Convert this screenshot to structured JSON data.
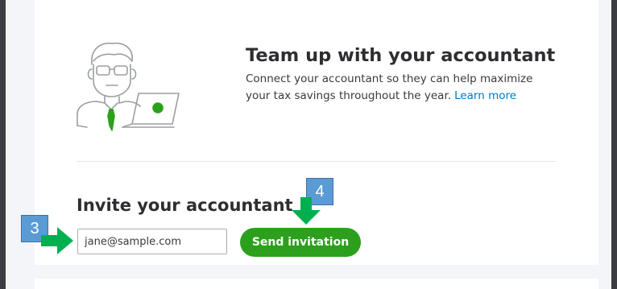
{
  "promo": {
    "title": "Team up with your accountant",
    "description": "Connect your accountant so they can help maximize your tax savings throughout the year.",
    "learn_more": "Learn more"
  },
  "invite": {
    "title": "Invite your accountant",
    "email_value": "jane@sample.com",
    "send_label": "Send invitation"
  },
  "annotations": {
    "step_3": "3",
    "step_4": "4"
  },
  "colors": {
    "accent_green": "#2ca01c",
    "link_blue": "#0077c5",
    "callout_blue": "#5b9bd5",
    "arrow_green": "#00b050"
  },
  "icons": {
    "illustration": "accountant-with-laptop-illustration",
    "arrow_right": "green-arrow-right",
    "arrow_down": "green-arrow-down"
  }
}
